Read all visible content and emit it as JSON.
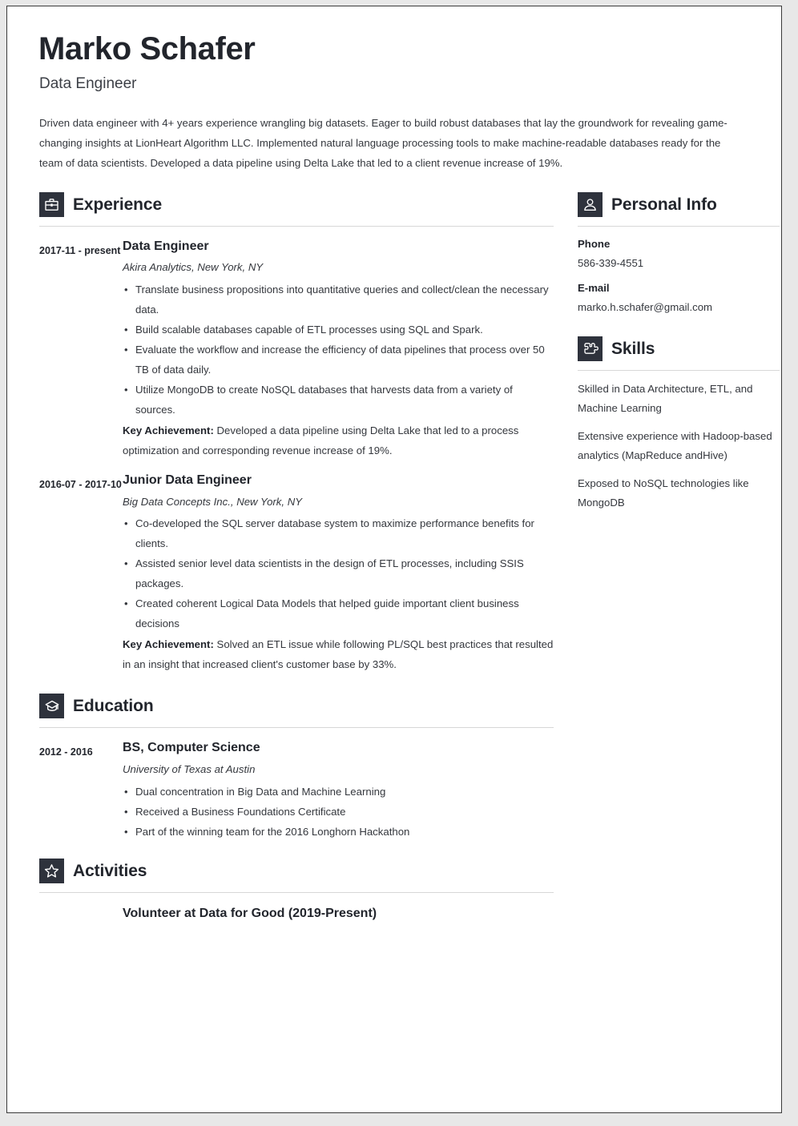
{
  "header": {
    "name": "Marko Schafer",
    "job_title": "Data Engineer",
    "summary": "Driven data engineer with 4+ years experience wrangling big datasets. Eager to build robust databases that lay the groundwork for revealing game-changing insights at LionHeart Algorithm LLC. Implemented natural language processing tools to make machine-readable databases ready for the team of data scientists. Developed a data pipeline using Delta Lake that led to a client revenue increase of 19%."
  },
  "sections": {
    "experience": {
      "title": "Experience",
      "icon": "briefcase-icon",
      "entries": [
        {
          "dates": "2017-11 - present",
          "title": "Data Engineer",
          "subtitle": "Akira Analytics, New York, NY",
          "bullets": [
            "Translate business propositions into quantitative queries and collect/clean the necessary data.",
            "Build scalable databases capable of ETL processes using SQL and Spark.",
            "Evaluate the workflow and increase the efficiency of data pipelines that process over 50 TB of data daily.",
            "Utilize MongoDB to create NoSQL databases that harvests data from a variety of sources."
          ],
          "key_achievement_label": "Key Achievement:",
          "key_achievement_text": " Developed a data pipeline using Delta Lake that led to a process optimization and corresponding revenue increase of 19%."
        },
        {
          "dates": "2016-07 - 2017-10",
          "title": "Junior Data Engineer",
          "subtitle": "Big Data Concepts Inc., New York, NY",
          "bullets": [
            "Co-developed the SQL server database system to maximize performance benefits for clients.",
            "Assisted senior level data scientists in the design of ETL processes, including SSIS packages.",
            "Created coherent Logical Data Models that helped guide important client business decisions"
          ],
          "key_achievement_label": "Key Achievement:",
          "key_achievement_text": " Solved an ETL issue while following PL/SQL best practices that resulted in an insight that increased client's customer base by 33%."
        }
      ]
    },
    "education": {
      "title": "Education",
      "icon": "graduation-cap-icon",
      "entries": [
        {
          "dates": "2012 - 2016",
          "title": "BS, Computer Science",
          "subtitle": "University of Texas at Austin",
          "bullets": [
            "Dual concentration in Big Data and Machine Learning",
            "Received a Business Foundations Certificate",
            "Part of the winning team for the 2016 Longhorn Hackathon"
          ]
        }
      ]
    },
    "activities": {
      "title": "Activities",
      "icon": "star-icon",
      "entries": [
        {
          "dates": "",
          "title": "Volunteer at Data for Good (2019-Present)"
        }
      ]
    },
    "personal_info": {
      "title": "Personal Info",
      "icon": "person-icon",
      "fields": [
        {
          "label": "Phone",
          "value": "586-339-4551"
        },
        {
          "label": "E-mail",
          "value": "marko.h.schafer@gmail.com"
        }
      ]
    },
    "skills": {
      "title": "Skills",
      "icon": "puzzle-piece-icon",
      "items": [
        "Skilled in Data Architecture, ETL, and Machine Learning",
        "Extensive experience with Hadoop-based analytics (MapReduce andHive)",
        "Exposed to NoSQL technologies like MongoDB"
      ]
    }
  },
  "colors": {
    "icon_background": "#2e323c",
    "heading_text": "#22252c",
    "body_text": "#34373d",
    "divider": "#d7d7d7",
    "page_background": "#ffffff",
    "canvas_background": "#e8e8e8"
  }
}
